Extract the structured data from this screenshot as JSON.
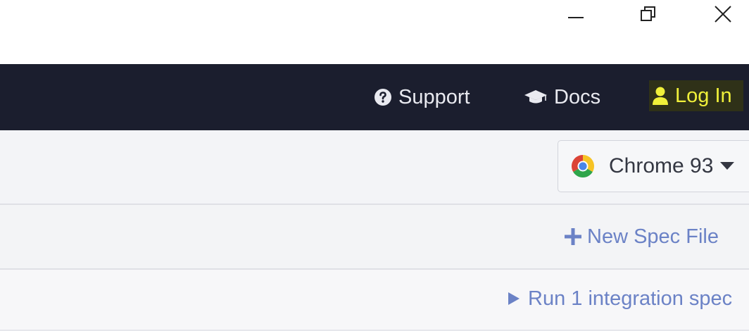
{
  "window_controls": {
    "minimize_icon": "minimize-icon",
    "maximize_icon": "restore-icon",
    "close_icon": "close-icon"
  },
  "nav": {
    "support_label": "Support",
    "support_icon": "question-circle-icon",
    "docs_label": "Docs",
    "docs_icon": "graduation-cap-icon",
    "login_label": "Log In",
    "login_icon": "user-icon"
  },
  "browser_selector": {
    "label": "Chrome 93",
    "icon": "chrome-icon"
  },
  "specs": {
    "new_spec_label": "New Spec File",
    "run_label": "Run 1 integration spec"
  },
  "colors": {
    "nav_background": "#1b1e2e",
    "login_highlight": "#f0f03a",
    "link": "#6b82c6"
  }
}
